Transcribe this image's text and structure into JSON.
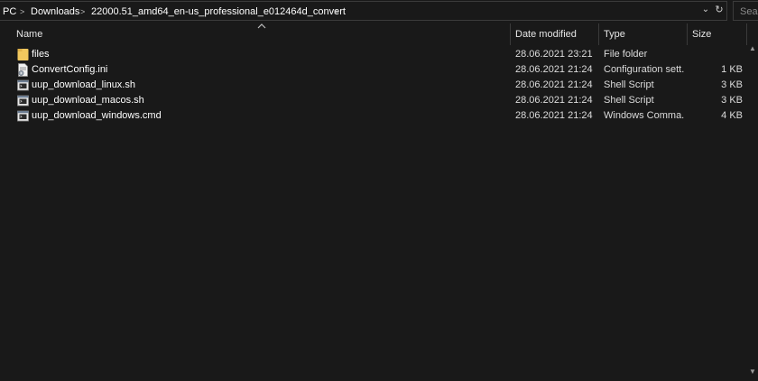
{
  "address": {
    "crumbs": [
      "PC",
      "Downloads",
      "22000.51_amd64_en-us_professional_e012464d_convert"
    ],
    "separator": ">",
    "dropdown_glyph": "⌄",
    "refresh_glyph": "↻"
  },
  "search": {
    "placeholder": "Searc"
  },
  "columns": {
    "name": "Name",
    "date": "Date modified",
    "type": "Type",
    "size": "Size"
  },
  "files": [
    {
      "name": "files",
      "date": "28.06.2021 23:21",
      "type": "File folder",
      "size": "",
      "icon": "folder-icon"
    },
    {
      "name": "ConvertConfig.ini",
      "date": "28.06.2021 21:24",
      "type": "Configuration sett...",
      "size": "1 KB",
      "icon": "config-file-icon"
    },
    {
      "name": "uup_download_linux.sh",
      "date": "28.06.2021 21:24",
      "type": "Shell Script",
      "size": "3 KB",
      "icon": "script-file-icon"
    },
    {
      "name": "uup_download_macos.sh",
      "date": "28.06.2021 21:24",
      "type": "Shell Script",
      "size": "3 KB",
      "icon": "script-file-icon"
    },
    {
      "name": "uup_download_windows.cmd",
      "date": "28.06.2021 21:24",
      "type": "Windows Comma...",
      "size": "4 KB",
      "icon": "script-file-icon"
    }
  ],
  "colors": {
    "background": "#191919",
    "folder": "#f0c75e",
    "divider": "#3a3a3a"
  }
}
